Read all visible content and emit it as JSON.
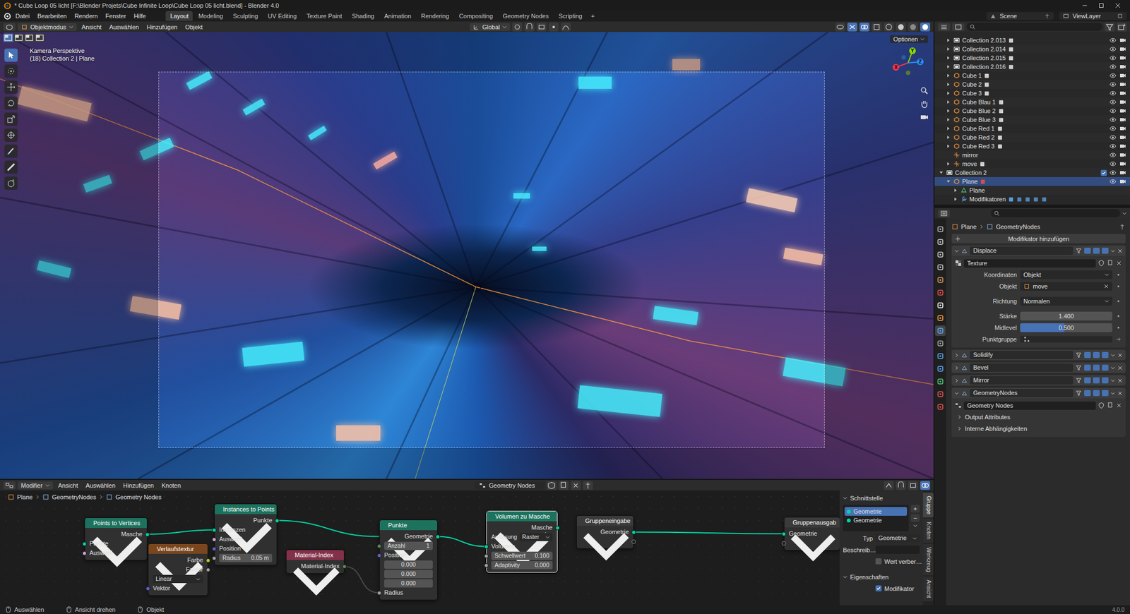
{
  "window": {
    "title": "* Cube Loop 05 licht [F:\\Blender Projets\\Cube Infinite Loop\\Cube Loop 05 licht.blend] - Blender 4.0"
  },
  "menu": [
    "Datei",
    "Bearbeiten",
    "Rendern",
    "Fenster",
    "Hilfe"
  ],
  "workspaces": [
    {
      "label": "Layout",
      "selected": true
    },
    {
      "label": "Modeling",
      "selected": false
    },
    {
      "label": "Sculpting",
      "selected": false
    },
    {
      "label": "UV Editing",
      "selected": false
    },
    {
      "label": "Texture Paint",
      "selected": false
    },
    {
      "label": "Shading",
      "selected": false
    },
    {
      "label": "Animation",
      "selected": false
    },
    {
      "label": "Rendering",
      "selected": false
    },
    {
      "label": "Compositing",
      "selected": false
    },
    {
      "label": "Geometry Nodes",
      "selected": false
    },
    {
      "label": "Scripting",
      "selected": false
    }
  ],
  "add_workspace": "+",
  "scene": "Scene",
  "view_layer": "ViewLayer",
  "viewport": {
    "mode": "Objektmodus",
    "menus": [
      "Ansicht",
      "Auswählen",
      "Hinzufügen",
      "Objekt"
    ],
    "orientation": "Global",
    "options": "Optionen",
    "overlay": [
      "Kamera Perspektive",
      "(18) Collection 2 | Plane"
    ],
    "tools": [
      {
        "kind": "select",
        "selected": true
      },
      {
        "kind": "cursor",
        "selected": false
      },
      {
        "kind": "move",
        "selected": false
      },
      {
        "kind": "rotate",
        "selected": false
      },
      {
        "kind": "scale",
        "selected": false
      },
      {
        "kind": "transform",
        "selected": false
      },
      {
        "kind": "annotate",
        "selected": false
      },
      {
        "kind": "measure",
        "selected": false
      },
      {
        "kind": "add",
        "selected": false
      }
    ],
    "gizmo_axes": [
      {
        "label": "X",
        "color": "#ff3352"
      },
      {
        "label": "Y",
        "color": "#8bdc00"
      },
      {
        "label": "Z",
        "color": "#2890ff"
      }
    ]
  },
  "outliner": {
    "rows": [
      {
        "name": "Collection 2.013",
        "level": 1,
        "icon": "collection",
        "children": true,
        "expanded": false,
        "selected": false,
        "sub_icons": 1,
        "checkbox": false,
        "visible": true
      },
      {
        "name": "Collection 2.014",
        "level": 1,
        "icon": "collection",
        "children": true,
        "expanded": false,
        "selected": false,
        "sub_icons": 1,
        "checkbox": false,
        "visible": true
      },
      {
        "name": "Collection 2.015",
        "level": 1,
        "icon": "collection",
        "children": true,
        "expanded": false,
        "selected": false,
        "sub_icons": 1,
        "checkbox": false,
        "visible": true
      },
      {
        "name": "Collection 2.016",
        "level": 1,
        "icon": "collection",
        "children": true,
        "expanded": false,
        "selected": false,
        "sub_icons": 1,
        "checkbox": false,
        "visible": true
      },
      {
        "name": "Cube 1",
        "level": 1,
        "icon": "object",
        "children": true,
        "expanded": false,
        "selected": false,
        "sub_icons": 1,
        "checkbox": false,
        "visible": true
      },
      {
        "name": "Cube 2",
        "level": 1,
        "icon": "object",
        "children": true,
        "expanded": false,
        "selected": false,
        "sub_icons": 1,
        "checkbox": false,
        "visible": true
      },
      {
        "name": "Cube 3",
        "level": 1,
        "icon": "object",
        "children": true,
        "expanded": false,
        "selected": false,
        "sub_icons": 1,
        "checkbox": false,
        "visible": true
      },
      {
        "name": "Cube Blau 1",
        "level": 1,
        "icon": "object",
        "children": true,
        "expanded": false,
        "selected": false,
        "sub_icons": 1,
        "checkbox": false,
        "visible": true
      },
      {
        "name": "Cube Blue 2",
        "level": 1,
        "icon": "object",
        "children": true,
        "expanded": false,
        "selected": false,
        "sub_icons": 1,
        "checkbox": false,
        "visible": true
      },
      {
        "name": "Cube Blue 3",
        "level": 1,
        "icon": "object",
        "children": true,
        "expanded": false,
        "selected": false,
        "sub_icons": 1,
        "checkbox": false,
        "visible": true
      },
      {
        "name": "Cube Red 1",
        "level": 1,
        "icon": "object",
        "children": true,
        "expanded": false,
        "selected": false,
        "sub_icons": 1,
        "checkbox": false,
        "visible": true
      },
      {
        "name": "Cube Red 2",
        "level": 1,
        "icon": "object",
        "children": true,
        "expanded": false,
        "selected": false,
        "sub_icons": 1,
        "checkbox": false,
        "visible": true
      },
      {
        "name": "Cube Red 3",
        "level": 1,
        "icon": "object",
        "children": true,
        "expanded": false,
        "selected": false,
        "sub_icons": 1,
        "checkbox": false,
        "visible": true
      },
      {
        "name": "mirror",
        "level": 1,
        "icon": "empty",
        "children": false,
        "expanded": false,
        "selected": false,
        "sub_icons": 0,
        "checkbox": false,
        "visible": true
      },
      {
        "name": "move",
        "level": 1,
        "icon": "empty",
        "children": true,
        "expanded": false,
        "selected": false,
        "sub_icons": 1,
        "checkbox": false,
        "visible": true
      },
      {
        "name": "Collection 2",
        "level": 0,
        "icon": "collection",
        "children": true,
        "expanded": true,
        "selected": false,
        "sub_icons": 0,
        "checkbox": true,
        "visible": true
      },
      {
        "name": "Plane",
        "level": 1,
        "icon": "object",
        "children": true,
        "expanded": true,
        "selected": true,
        "sub_icons": 1,
        "checkbox": false,
        "visible": true
      },
      {
        "name": "Plane",
        "level": 2,
        "icon": "mesh",
        "children": true,
        "expanded": false,
        "selected": false,
        "sub_icons": 0,
        "checkbox": false,
        "visible": false
      },
      {
        "name": "Modifikatoren",
        "level": 2,
        "icon": "modifier",
        "children": true,
        "expanded": false,
        "selected": false,
        "sub_icons": 5,
        "checkbox": false,
        "visible": false
      }
    ]
  },
  "properties": {
    "tabs": [
      {
        "color": "#a8a8a8",
        "selected": false
      },
      {
        "color": "#b8b8b8",
        "selected": false
      },
      {
        "color": "#b8b8b8",
        "selected": false
      },
      {
        "color": "#b8b8b8",
        "selected": false
      },
      {
        "color": "#c98a5a",
        "selected": false
      },
      {
        "color": "#d04848",
        "selected": false
      },
      {
        "color": "#e6e6e6",
        "selected": false
      },
      {
        "color": "#e8913f",
        "selected": false
      },
      {
        "color": "#5a9ae0",
        "selected": true
      },
      {
        "color": "#9a9a9a",
        "selected": false
      },
      {
        "color": "#5a9ae0",
        "selected": false
      },
      {
        "color": "#5a9ae0",
        "selected": false
      },
      {
        "color": "#4cb86f",
        "selected": false
      },
      {
        "color": "#d05050",
        "selected": false
      },
      {
        "color": "#d05050",
        "selected": false
      }
    ],
    "breadcrumb": [
      "Plane",
      "GeometryNodes"
    ],
    "add_modifier": "Modifikator hinzufügen",
    "modifiers": [
      {
        "name": "Displace",
        "expanded": true,
        "texture": "Texture",
        "fields": [
          {
            "label": "Koordinaten",
            "value": "Objekt",
            "kind": "dropdown"
          },
          {
            "label": "Objekt",
            "value": "move",
            "kind": "object"
          },
          {
            "label": "Richtung",
            "value": "Normalen",
            "kind": "dropdown"
          },
          {
            "label": "Stärke",
            "value": "1.400",
            "kind": "number"
          },
          {
            "label": "Midlevel",
            "value": "0.500",
            "kind": "slider",
            "level": 0.48
          },
          {
            "label": "Punktgruppe",
            "value": "",
            "kind": "group"
          }
        ]
      },
      {
        "name": "Solidify",
        "expanded": false
      },
      {
        "name": "Bevel",
        "expanded": false
      },
      {
        "name": "Mirror",
        "expanded": false
      },
      {
        "name": "GeometryNodes",
        "expanded": true,
        "group": "Geometry Nodes",
        "panels": [
          {
            "label": "Output Attributes",
            "expanded": false
          },
          {
            "label": "Interne Abhängigkeiten",
            "expanded": false
          }
        ]
      }
    ]
  },
  "node_editor": {
    "mode": "Modifier",
    "menus": [
      "Ansicht",
      "Auswählen",
      "Hinzufügen",
      "Knoten"
    ],
    "node_group": "Geometry Nodes",
    "breadcrumb": [
      "Plane",
      "GeometryNodes",
      "Geometry Nodes"
    ],
    "nodes": [
      {
        "title": "Points to Vertices",
        "color": "#1d725e",
        "selected": false,
        "rows": [
          {
            "kind": "output",
            "label": "Masche",
            "socket": "geometry"
          },
          {
            "kind": "input",
            "label": "Punkte",
            "socket": "geometry"
          },
          {
            "kind": "input",
            "label": "Auswahl",
            "socket": "bool"
          }
        ]
      },
      {
        "title": "Instances to Points",
        "color": "#1d725e",
        "selected": false,
        "rows": [
          {
            "kind": "output",
            "label": "Punkte",
            "socket": "geometry"
          },
          {
            "kind": "input",
            "label": "Instanzen",
            "socket": "geometry"
          },
          {
            "kind": "input",
            "label": "Auswahl",
            "socket": "bool"
          },
          {
            "kind": "input",
            "label": "Position",
            "socket": "vector"
          },
          {
            "kind": "field",
            "label": "Radius",
            "value": "0.05 m",
            "socket": "float"
          }
        ]
      },
      {
        "title": "Verlaufstextur",
        "color": "#79461d",
        "selected": false,
        "rows": [
          {
            "kind": "output",
            "label": "Farbe",
            "socket": "color"
          },
          {
            "kind": "output",
            "label": "Faktor",
            "socket": "float"
          },
          {
            "kind": "dropdown",
            "value": "Linear"
          },
          {
            "kind": "input",
            "label": "Vektor",
            "socket": "vector"
          }
        ]
      },
      {
        "title": "Material-Index",
        "color": "#83314a",
        "selected": false,
        "rows": [
          {
            "kind": "output",
            "label": "Material-Index",
            "socket": "int"
          }
        ]
      },
      {
        "title": "Punkte",
        "color": "#1d725e",
        "selected": false,
        "rows": [
          {
            "kind": "output",
            "label": "Geometrie",
            "socket": "geometry"
          },
          {
            "kind": "field",
            "label": "Anzahl",
            "value": "1",
            "socket": "int"
          },
          {
            "kind": "label",
            "label": "Position:",
            "socket": "vector"
          },
          {
            "kind": "number",
            "value": "0.000"
          },
          {
            "kind": "number",
            "value": "0.000"
          },
          {
            "kind": "number",
            "value": "0.000"
          },
          {
            "kind": "input",
            "label": "Radius",
            "socket": "float"
          }
        ]
      },
      {
        "title": "Volumen zu Masche",
        "color": "#1d725e",
        "selected": true,
        "rows": [
          {
            "kind": "output",
            "label": "Masche",
            "socket": "geometry"
          },
          {
            "kind": "dropdown",
            "label": "Auflösung",
            "value": "Raster"
          },
          {
            "kind": "input",
            "label": "Volumen",
            "socket": "geometry"
          },
          {
            "kind": "field",
            "label": "Schwellwert",
            "value": "0.100",
            "socket": "float"
          },
          {
            "kind": "field",
            "label": "Adaptivity",
            "value": "0.000",
            "socket": "float"
          }
        ]
      },
      {
        "title": "Gruppeneingabe",
        "color": "#3b3b3b",
        "selected": false,
        "rows": [
          {
            "kind": "output",
            "label": "Geometrie",
            "socket": "geometry"
          },
          {
            "kind": "virtual",
            "side": "out"
          }
        ]
      },
      {
        "title": "Gruppenausgab",
        "color": "#3b3b3b",
        "selected": false,
        "rows": [
          {
            "kind": "input",
            "label": "Geometrie",
            "socket": "geometry"
          },
          {
            "kind": "virtual",
            "side": "in"
          }
        ]
      }
    ],
    "links": [
      {
        "from": [
          0,
          0
        ],
        "to": [
          1,
          1
        ]
      },
      {
        "from": [
          1,
          0
        ],
        "to": [
          4,
          0
        ]
      },
      {
        "from": [
          4,
          0
        ],
        "to": [
          5,
          2
        ]
      },
      {
        "from": [
          3,
          0
        ],
        "to": [
          4,
          6
        ]
      },
      {
        "from": [
          6,
          0
        ],
        "to": [
          7,
          0
        ]
      }
    ],
    "sidebar": {
      "tabs": [
        {
          "label": "Gruppe",
          "selected": true
        },
        {
          "label": "Knoten",
          "selected": false
        },
        {
          "label": "Werkzeug",
          "selected": false
        },
        {
          "label": "Ansicht",
          "selected": false
        }
      ],
      "interface": {
        "title": "Schnittstelle",
        "expanded": true,
        "items": [
          {
            "label": "Geometrie",
            "selected": true
          },
          {
            "label": "Geometrie",
            "selected": false
          }
        ],
        "add": "+",
        "remove": "−",
        "type_label": "Typ",
        "type_value": "Geometrie",
        "description_label": "Beschreib…",
        "hide_value": {
          "label": "Wert verber…",
          "checked": false
        }
      },
      "properties": {
        "title": "Eigenschaften",
        "expanded": true,
        "modifier": {
          "label": "Modifikator",
          "checked": true
        }
      }
    }
  },
  "status_bar": {
    "items": [
      "Auswählen",
      "Ansicht drehen",
      "Objekt"
    ],
    "version": "4.0.0"
  }
}
